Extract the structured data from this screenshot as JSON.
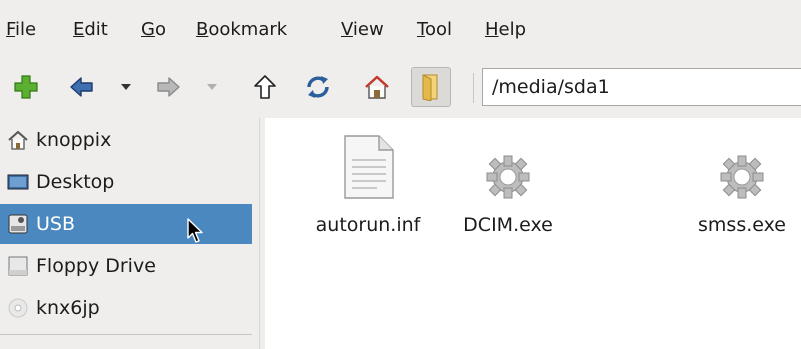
{
  "menu": [
    {
      "label": "File",
      "u": "F",
      "rest": "ile"
    },
    {
      "label": "Edit",
      "u": "E",
      "rest": "dit"
    },
    {
      "label": "Go",
      "u": "G",
      "rest": "o"
    },
    {
      "label": "Bookmark",
      "u": "B",
      "rest": "ookmark"
    },
    {
      "label": "View",
      "u": "V",
      "rest": "iew"
    },
    {
      "label": "Tool",
      "u": "T",
      "rest": "ool"
    },
    {
      "label": "Help",
      "u": "H",
      "rest": "elp"
    }
  ],
  "toolbar": {
    "icons": [
      "new-tab-icon",
      "back-icon",
      "back-history-icon",
      "forward-icon",
      "forward-history-icon",
      "up-icon",
      "reload-icon",
      "home-icon",
      "folder-icon"
    ]
  },
  "location": {
    "path": "/media/sda1"
  },
  "sidebar": {
    "items": [
      {
        "label": "knoppix",
        "icon": "home-icon"
      },
      {
        "label": "Desktop",
        "icon": "desktop-icon"
      },
      {
        "label": "USB",
        "icon": "usb-drive-icon",
        "selected": true
      },
      {
        "label": "Floppy Drive",
        "icon": "floppy-icon"
      },
      {
        "label": "knx6jp",
        "icon": "cd-icon"
      }
    ]
  },
  "files": [
    {
      "name": "autorun.inf",
      "icon": "text-file-icon"
    },
    {
      "name": "DCIM.exe",
      "icon": "executable-gear-icon"
    },
    {
      "name": "smss.exe",
      "icon": "executable-gear-icon"
    }
  ],
  "colors": {
    "selection": "#4a88bf",
    "background": "#efeeec",
    "view": "#ffffff"
  }
}
